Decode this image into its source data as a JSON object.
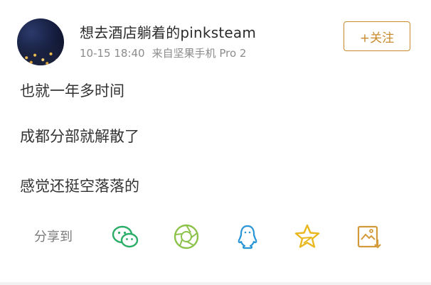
{
  "post": {
    "username": "想去酒店躺着的pinksteam",
    "timestamp": "10-15 18:40",
    "source": "来自坚果手机 Pro 2",
    "follow_label": "+关注",
    "lines": [
      "也就一年多时间",
      "成都分部就解散了",
      "感觉还挺空落落的"
    ]
  },
  "share": {
    "label": "分享到",
    "targets": [
      {
        "icon": "wechat-icon",
        "color": "#2aae67"
      },
      {
        "icon": "moments-icon",
        "color": "#8cc24a"
      },
      {
        "icon": "qq-icon",
        "color": "#2b96d6"
      },
      {
        "icon": "qzone-star-icon",
        "color": "#e8b81e"
      },
      {
        "icon": "save-image-icon",
        "color": "#d39a3a"
      }
    ]
  },
  "colors": {
    "accent": "#c98a2c",
    "text": "#333333",
    "meta": "#8c8c8c"
  }
}
